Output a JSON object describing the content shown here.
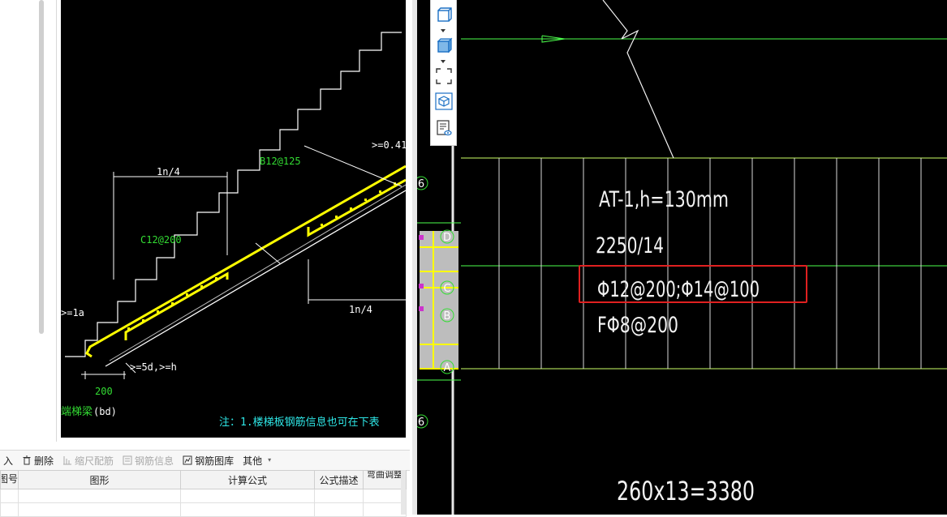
{
  "detail_drawing": {
    "labels": {
      "top_ratio": ">=0.41",
      "top_rebar": "B12@125",
      "ln4_top": "1n/4",
      "mid_rebar": "C12@200",
      "ln4_bottom": "1n/4",
      "la": ">=1a",
      "anchor": ">=5d,>=h",
      "dim_200": "200",
      "beam_label": "端梯梁",
      "beam_suffix": "(bd)",
      "note": "注：1.楼梯板钢筋信息也可在下表"
    }
  },
  "toolbar": {
    "items": [
      {
        "label": "入",
        "icon": "insert-icon",
        "disabled": false
      },
      {
        "label": "删除",
        "icon": "trash-icon",
        "disabled": false
      },
      {
        "label": "缩尺配筋",
        "icon": "scale-rebar-icon",
        "disabled": true
      },
      {
        "label": "钢筋信息",
        "icon": "rebar-info-icon",
        "disabled": true
      },
      {
        "label": "钢筋图库",
        "icon": "rebar-library-icon",
        "disabled": false
      },
      {
        "label": "其他",
        "icon": "chevron-down-icon",
        "disabled": false
      }
    ]
  },
  "table": {
    "columns": [
      "图号",
      "图形",
      "计算公式",
      "公式描述",
      "弯曲调整"
    ]
  },
  "navigator": {
    "markers": [
      "6",
      "D",
      "C",
      "B",
      "A",
      "6"
    ]
  },
  "main_drawing": {
    "title": "AT-1,h=130mm",
    "span": "2250/14",
    "rebar_main": "Φ12@200;Φ14@100",
    "rebar_dist": "FΦ8@200",
    "dimension": "260x13=3380"
  },
  "colors": {
    "canvas_bg": "#000000",
    "cad_yellow": "#ffff00",
    "cad_green": "#33dd33",
    "cad_cyan": "#2ee6e6",
    "highlight": "#e02020",
    "grid_green": "#4cff4c",
    "grid_lime": "#ccff66"
  }
}
